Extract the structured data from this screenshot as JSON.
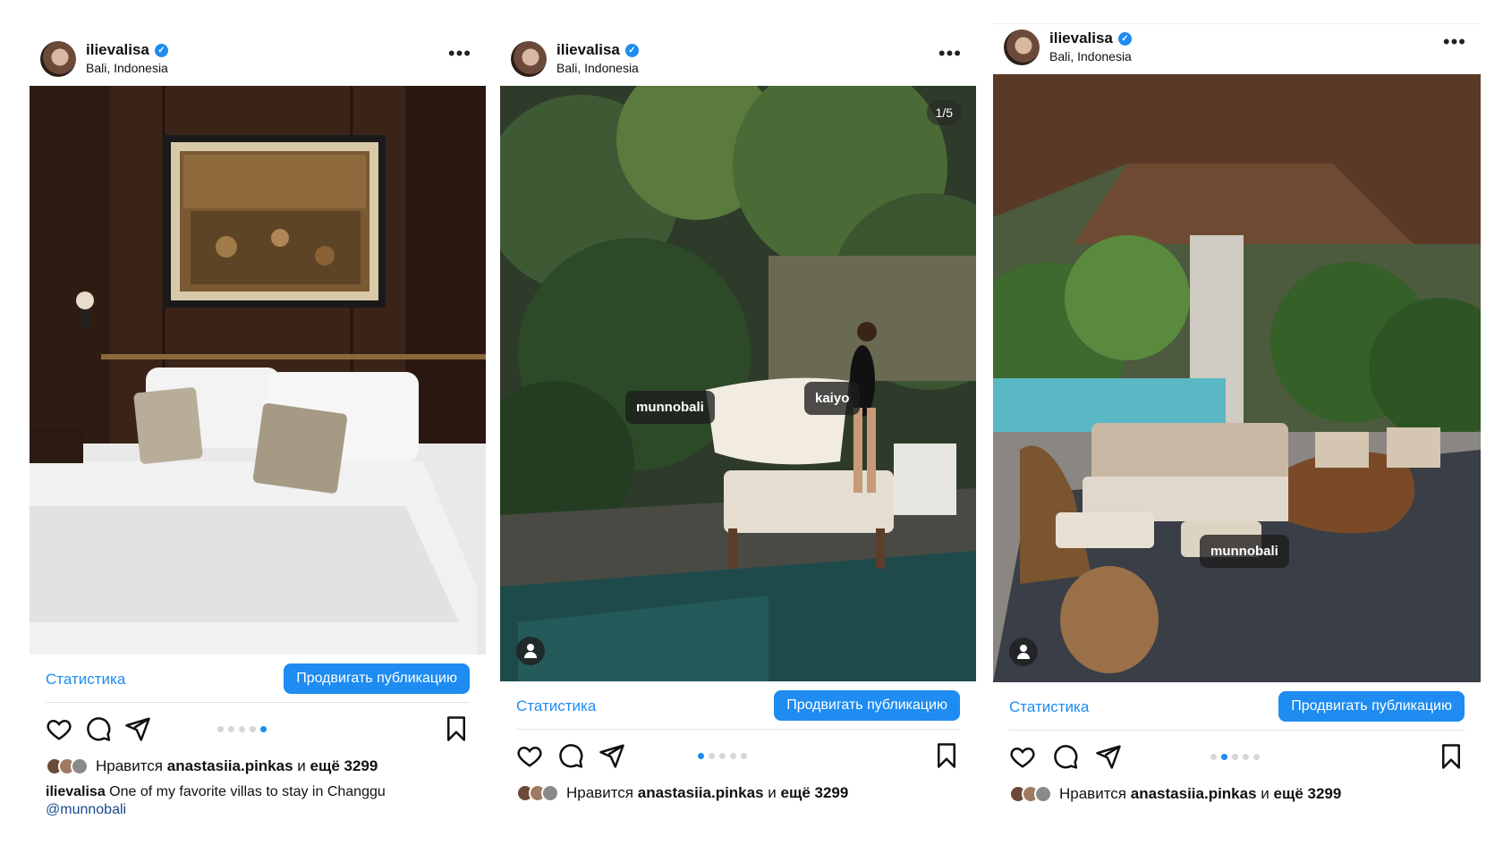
{
  "posts": [
    {
      "username": "ilievalisa",
      "location": "Bali, Indonesia",
      "stats_label": "Статистика",
      "promote_label": "Продвигать публикацию",
      "likes_prefix": "Нравится",
      "likes_user": "anastasiia.pinkas",
      "likes_connector": "и",
      "likes_more": "ещё 3299",
      "caption_user": "ilievalisa",
      "caption_text": "One of my favorite villas to stay in Changgu",
      "caption_mention": "@munnobali",
      "active_dot": 4,
      "dot_count": 5
    },
    {
      "username": "ilievalisa",
      "location": "Bali, Indonesia",
      "counter": "1/5",
      "tags": [
        "munnobali",
        "kaiyo"
      ],
      "stats_label": "Статистика",
      "promote_label": "Продвигать публикацию",
      "likes_prefix": "Нравится",
      "likes_user": "anastasiia.pinkas",
      "likes_connector": "и",
      "likes_more": "ещё 3299",
      "active_dot": 0,
      "dot_count": 5
    },
    {
      "username": "ilievalisa",
      "location": "Bali, Indonesia",
      "tags": [
        "munnobali"
      ],
      "stats_label": "Статистика",
      "promote_label": "Продвигать публикацию",
      "likes_prefix": "Нравится",
      "likes_user": "anastasiia.pinkas",
      "likes_connector": "и",
      "likes_more": "ещё 3299",
      "active_dot": 1,
      "dot_count": 5
    }
  ],
  "icons": {
    "heart": "heart-icon",
    "comment": "comment-icon",
    "share": "share-icon",
    "bookmark": "bookmark-icon",
    "more": "more-icon",
    "verified": "verified-badge-icon",
    "user_tag": "user-tag-icon"
  },
  "colors": {
    "accent": "#1e8cf0",
    "mention": "#1a4b8c",
    "divider": "#e3e3e3"
  }
}
